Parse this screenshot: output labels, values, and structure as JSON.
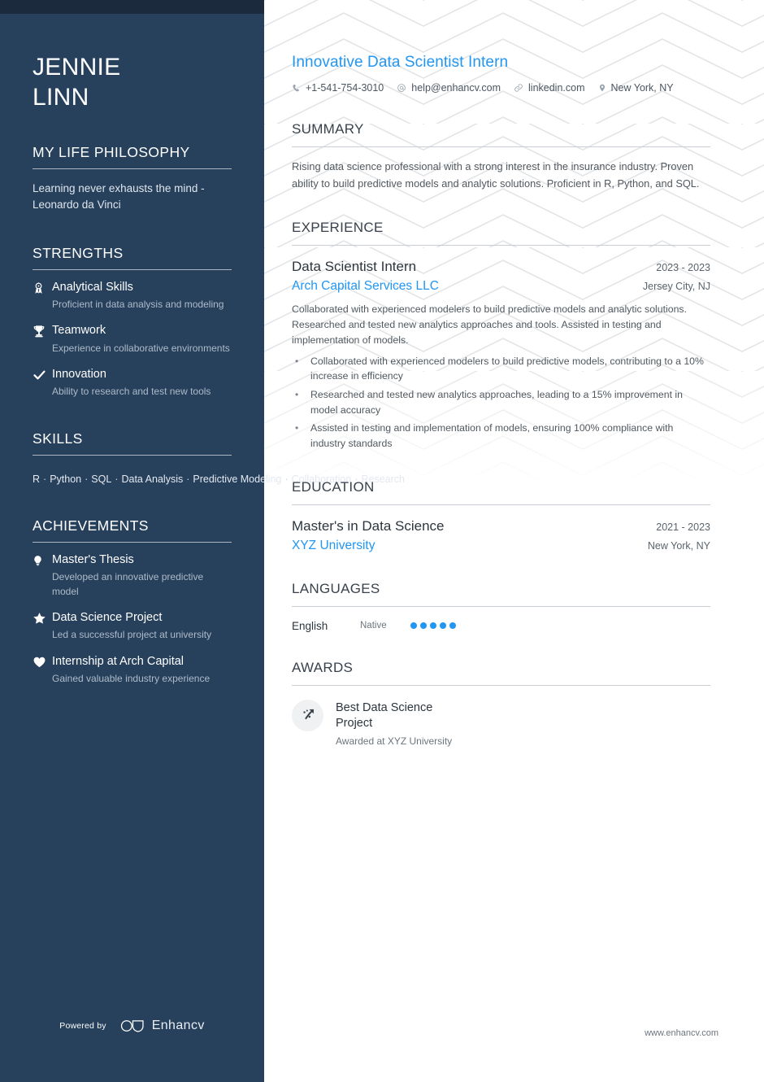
{
  "sidebar": {
    "name_first": "JENNIE",
    "name_last": "LINN",
    "philosophy": {
      "heading": "MY LIFE PHILOSOPHY",
      "text": "Learning never exhausts the mind - Leonardo da Vinci"
    },
    "strengths": {
      "heading": "STRENGTHS",
      "items": [
        {
          "icon": "award-medal-icon",
          "title": "Analytical Skills",
          "desc": "Proficient in data analysis and modeling"
        },
        {
          "icon": "trophy-icon",
          "title": "Teamwork",
          "desc": "Experience in collaborative environments"
        },
        {
          "icon": "check-icon",
          "title": "Innovation",
          "desc": "Ability to research and test new tools"
        }
      ]
    },
    "skills": {
      "heading": "SKILLS",
      "items": [
        "R",
        "Python",
        "SQL",
        "Data Analysis",
        "Predictive Modeling",
        "Collaboration",
        "Research"
      ],
      "separator": "·"
    },
    "achievements": {
      "heading": "ACHIEVEMENTS",
      "items": [
        {
          "icon": "lightbulb-icon",
          "title": "Master's Thesis",
          "desc": "Developed an innovative predictive model"
        },
        {
          "icon": "star-icon",
          "title": "Data Science Project",
          "desc": "Led a successful project at university"
        },
        {
          "icon": "heart-icon",
          "title": "Internship at Arch Capital",
          "desc": "Gained valuable industry experience"
        }
      ]
    },
    "footer": {
      "powered_by": "Powered by",
      "brand": "Enhancv"
    }
  },
  "main": {
    "job_title": "Innovative Data Scientist Intern",
    "contacts": [
      {
        "icon": "phone-icon",
        "text": "+1-541-754-3010"
      },
      {
        "icon": "email-at-icon",
        "text": "help@enhancv.com"
      },
      {
        "icon": "link-icon",
        "text": "linkedin.com"
      },
      {
        "icon": "location-pin-icon",
        "text": "New York, NY"
      }
    ],
    "summary": {
      "heading": "SUMMARY",
      "text": "Rising data science professional with a strong interest in the insurance industry. Proven ability to build predictive models and analytic solutions. Proficient in R, Python, and SQL."
    },
    "experience": {
      "heading": "EXPERIENCE",
      "entries": [
        {
          "title": "Data Scientist Intern",
          "dates": "2023 - 2023",
          "organization": "Arch Capital Services LLC",
          "location": "Jersey City, NJ",
          "description": "Collaborated with experienced modelers to build predictive models and analytic solutions. Researched and tested new analytics approaches and tools. Assisted in testing and implementation of models.",
          "bullets": [
            "Collaborated with experienced modelers to build predictive models, contributing to a 10% increase in efficiency",
            "Researched and tested new analytics approaches, leading to a 15% improvement in model accuracy",
            "Assisted in testing and implementation of models, ensuring 100% compliance with industry standards"
          ]
        }
      ]
    },
    "education": {
      "heading": "EDUCATION",
      "entries": [
        {
          "title": "Master's in Data Science",
          "dates": "2021 - 2023",
          "organization": "XYZ University",
          "location": "New York, NY"
        }
      ]
    },
    "languages": {
      "heading": "LANGUAGES",
      "entries": [
        {
          "name": "English",
          "level": "Native",
          "filled": 5,
          "total": 5
        }
      ]
    },
    "awards": {
      "heading": "AWARDS",
      "entries": [
        {
          "icon": "trend-arrow-icon",
          "title": "Best Data Science Project",
          "desc": "Awarded at XYZ University"
        }
      ]
    },
    "site_url": "www.enhancv.com"
  },
  "colors": {
    "sidebar_bg": "#27405c",
    "topbar_bg": "#1b2b3d",
    "accent_blue": "#2196f3",
    "heading_dark": "#39424c",
    "body_text": "#50585f"
  }
}
